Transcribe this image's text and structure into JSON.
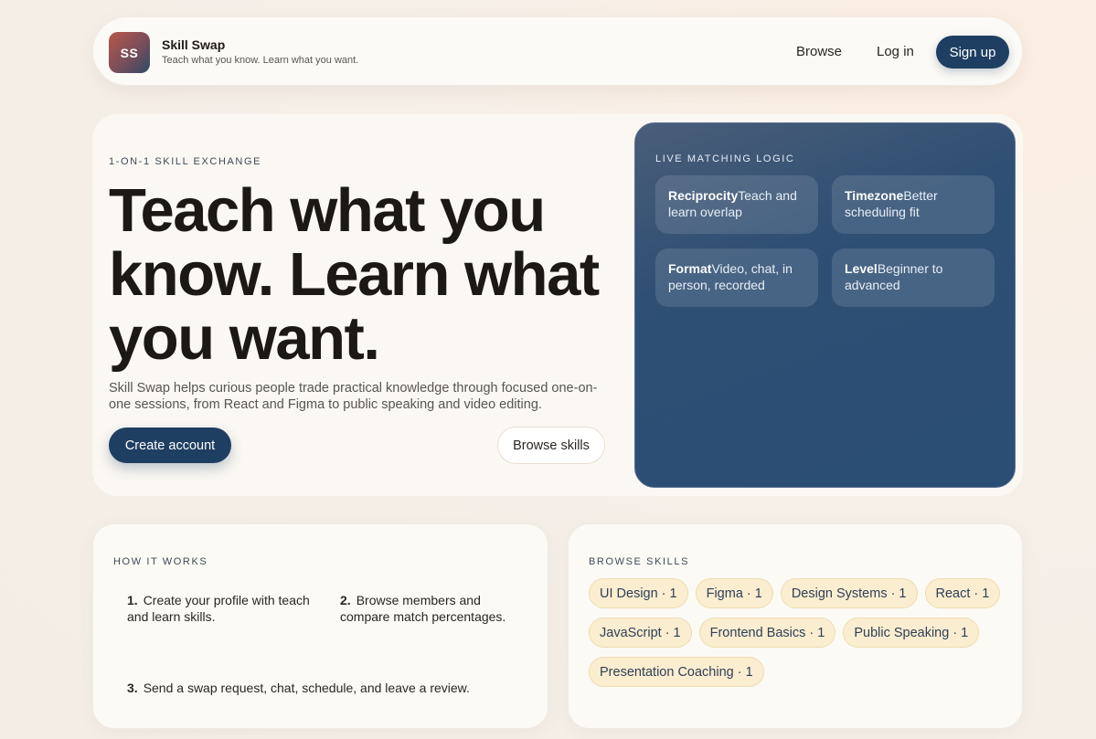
{
  "header": {
    "logo_text": "SS",
    "brand_name": "Skill Swap",
    "tagline": "Teach what you know. Learn what you want.",
    "nav": {
      "browse": "Browse",
      "login": "Log in",
      "signup": "Sign up"
    }
  },
  "hero": {
    "eyebrow": "1-ON-1 SKILL EXCHANGE",
    "headline": "Teach what you know. Learn what you want.",
    "description": "Skill Swap helps curious people trade practical knowledge through focused one-on-one sessions, from React and Figma to public speaking and video editing.",
    "primary_cta": "Create account",
    "secondary_cta": "Browse skills"
  },
  "matching": {
    "title": "LIVE MATCHING LOGIC",
    "items": [
      {
        "label": "Reciprocity",
        "text": "Teach and learn overlap"
      },
      {
        "label": "Timezone",
        "text": "Better scheduling fit"
      },
      {
        "label": "Format",
        "text": "Video, chat, in person, recorded"
      },
      {
        "label": "Level",
        "text": "Beginner to advanced"
      }
    ]
  },
  "how_it_works": {
    "title": "HOW IT WORKS",
    "steps": [
      {
        "num": "1.",
        "text": "Create your profile with teach and learn skills."
      },
      {
        "num": "2.",
        "text": "Browse members and compare match percentages."
      },
      {
        "num": "3.",
        "text": "Send a swap request, chat, schedule, and leave a review."
      }
    ]
  },
  "browse_skills": {
    "title": "BROWSE SKILLS",
    "skills": [
      {
        "name": "UI Design",
        "count": "· 1"
      },
      {
        "name": "Figma",
        "count": "· 1"
      },
      {
        "name": "Design Systems",
        "count": "· 1"
      },
      {
        "name": "React",
        "count": "· 1"
      },
      {
        "name": "JavaScript",
        "count": "· 1"
      },
      {
        "name": "Frontend Basics",
        "count": "· 1"
      },
      {
        "name": "Public Speaking",
        "count": "· 1"
      },
      {
        "name": "Presentation Coaching",
        "count": "· 1"
      }
    ]
  },
  "colors": {
    "primary": "#1e3f62",
    "chip_bg": "#fbedcf",
    "panel_bg": "#fcfaf5"
  }
}
